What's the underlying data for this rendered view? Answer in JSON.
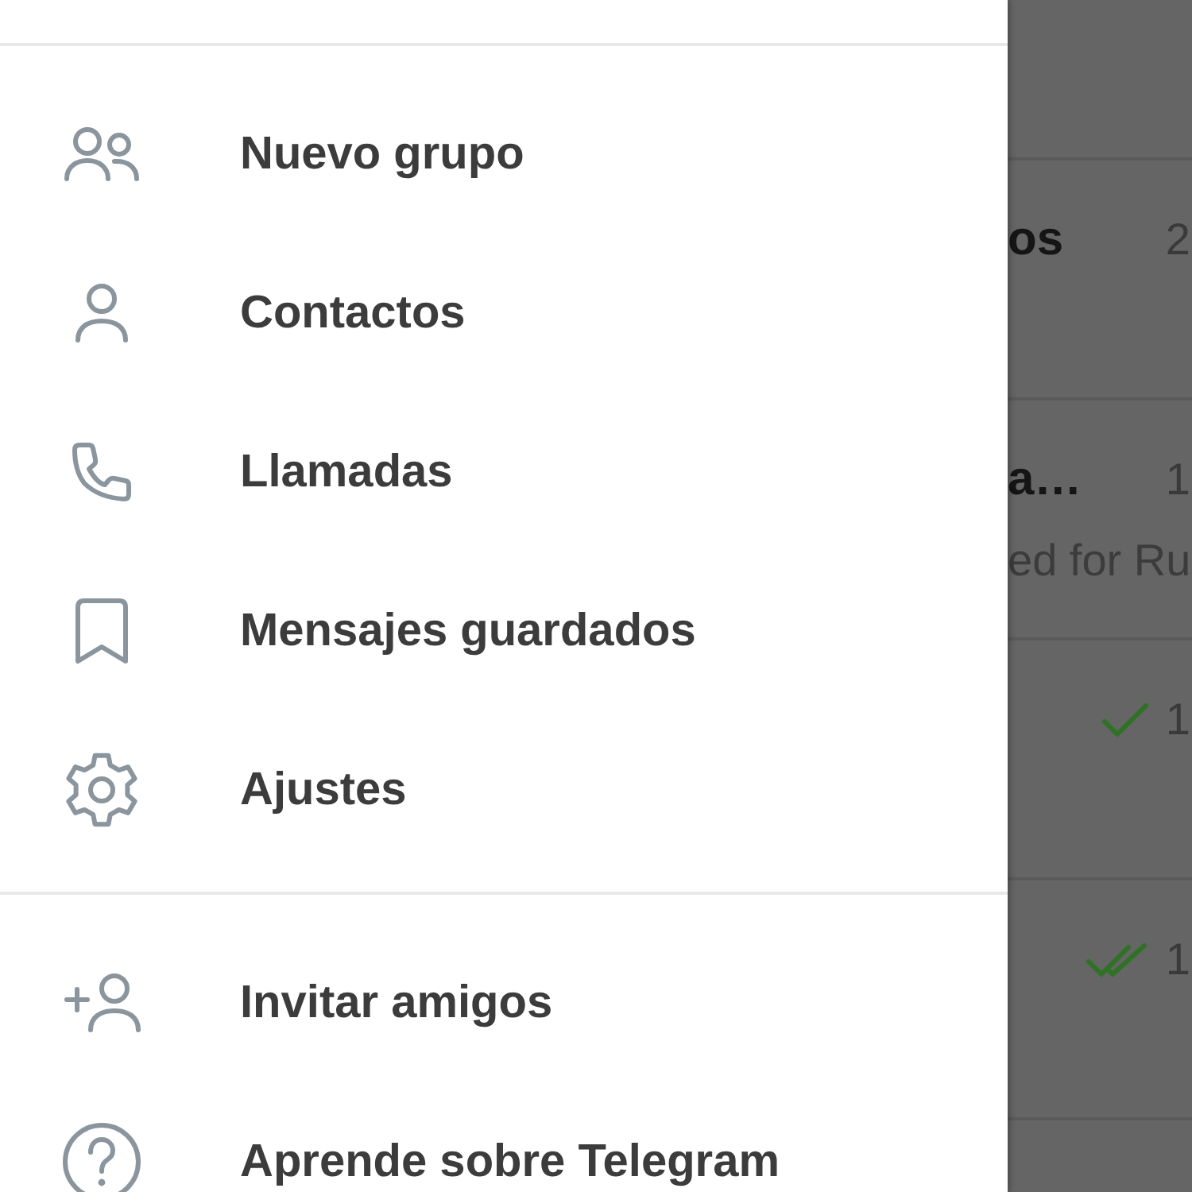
{
  "menu_sections": [
    {
      "items": [
        {
          "kind": "group",
          "label": "Nuevo grupo"
        },
        {
          "kind": "contacts",
          "label": "Contactos"
        },
        {
          "kind": "calls",
          "label": "Llamadas"
        },
        {
          "kind": "saved",
          "label": "Mensajes guardados"
        },
        {
          "kind": "settings",
          "label": "Ajustes"
        }
      ]
    },
    {
      "items": [
        {
          "kind": "invite",
          "label": "Invitar amigos"
        },
        {
          "kind": "help",
          "label": "Aprende sobre Telegram"
        }
      ]
    }
  ],
  "chat_list": {
    "rows": [
      {
        "title": "os",
        "time": "2"
      },
      {
        "title": "a…",
        "time": "1",
        "preview": "ed for Ru"
      },
      {
        "time": "1",
        "read": false
      },
      {
        "time": "1",
        "read": true
      }
    ]
  }
}
